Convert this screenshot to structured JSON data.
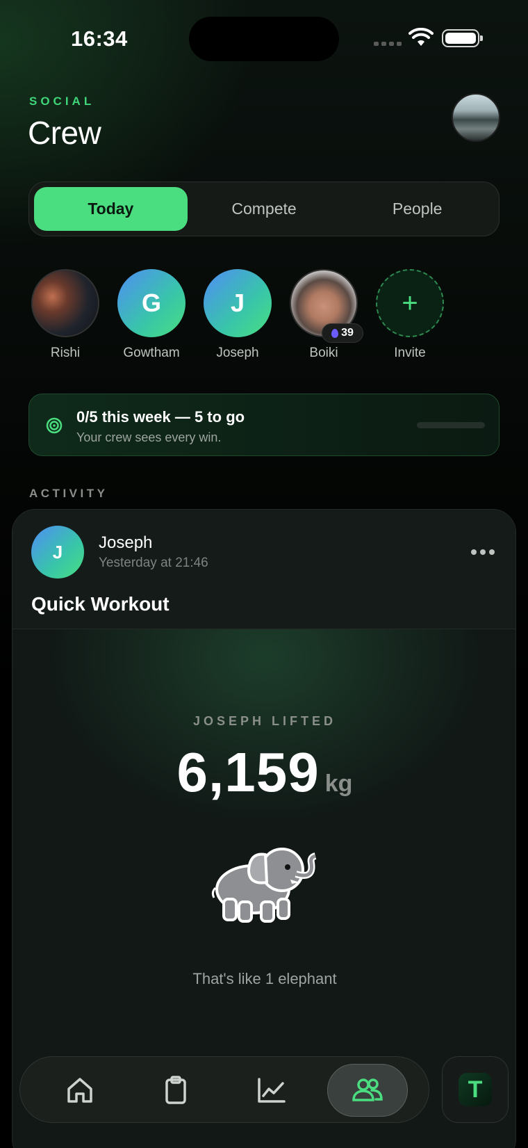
{
  "status_bar": {
    "time": "16:34"
  },
  "header": {
    "eyebrow": "SOCIAL",
    "title": "Crew"
  },
  "tabs": [
    {
      "label": "Today",
      "active": true
    },
    {
      "label": "Compete",
      "active": false
    },
    {
      "label": "People",
      "active": false
    }
  ],
  "people": [
    {
      "name": "Rishi",
      "type": "photo"
    },
    {
      "name": "Gowtham",
      "initial": "G"
    },
    {
      "name": "Joseph",
      "initial": "J"
    },
    {
      "name": "Boiki",
      "type": "photo",
      "streak": "39"
    },
    {
      "name": "Invite",
      "icon": "plus-icon"
    }
  ],
  "goal": {
    "title": "0/5 this week — 5 to go",
    "subtitle": "Your crew sees every win.",
    "progress": 0,
    "icon": "target-icon"
  },
  "activity": {
    "section_label": "ACTIVITY",
    "post": {
      "user_initial": "J",
      "user_name": "Joseph",
      "time": "Yesterday at 21:46",
      "title": "Quick Workout",
      "lift_label": "JOSEPH LIFTED",
      "lift_value": "6,159",
      "lift_unit": "kg",
      "comparison": "That's like 1 elephant",
      "illustration": "elephant-illustration"
    }
  },
  "tab_bar": {
    "items": [
      {
        "name": "home-icon",
        "active": false
      },
      {
        "name": "clipboard-icon",
        "active": false
      },
      {
        "name": "chart-icon",
        "active": false
      },
      {
        "name": "people-icon",
        "active": true
      }
    ],
    "app_button_letter": "T"
  },
  "colors": {
    "accent": "#4ade80",
    "background": "#000000",
    "card": "#141a18"
  }
}
